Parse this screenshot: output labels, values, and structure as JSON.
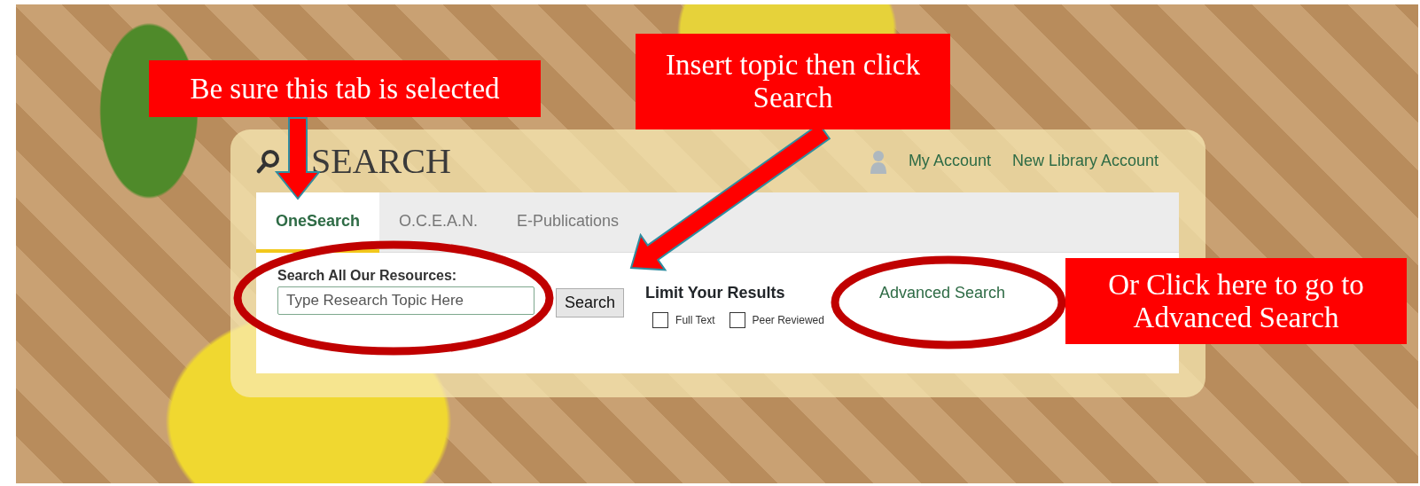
{
  "callouts": [
    {
      "text": "Be sure this tab is selected"
    },
    {
      "text": "Insert topic then click Search"
    },
    {
      "text": "Or Click here to go to Advanced Search"
    }
  ],
  "panel": {
    "title": "SEARCH",
    "links": [
      "My Account",
      "New Library Account"
    ],
    "tabs": [
      {
        "label": "OneSearch",
        "selected": true
      },
      {
        "label": "O.C.E.A.N.",
        "selected": false
      },
      {
        "label": "E-Publications",
        "selected": false
      }
    ],
    "search_label": "Search All Our Resources:",
    "search_value": "Type Research Topic Here",
    "search_button": "Search",
    "limit_label": "Limit Your Results",
    "filters": [
      {
        "label": "Full Text",
        "checked": false
      },
      {
        "label": "Peer Reviewed",
        "checked": false
      }
    ],
    "advanced_link": "Advanced Search"
  }
}
